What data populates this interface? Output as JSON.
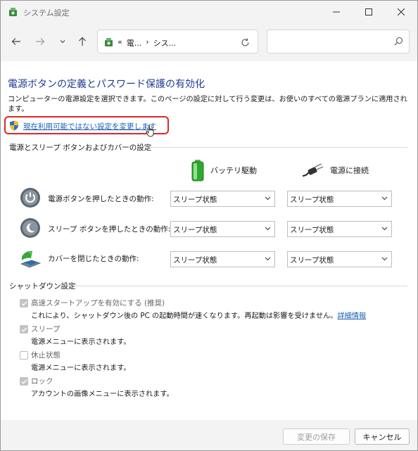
{
  "window": {
    "title": "システム設定"
  },
  "address": {
    "parts": [
      "«",
      "電...",
      "›",
      "シス..."
    ]
  },
  "search": {
    "placeholder": ""
  },
  "page": {
    "title": "電源ボタンの定義とパスワード保護の有効化",
    "description": "コンピューターの電源設定を選択できます。このページの設定に対して行う変更は、お使いのすべての電源プランに適用されます。",
    "change_link": "現在利用可能ではない設定を変更します"
  },
  "power_section": {
    "title": "電源とスリープ ボタンおよびカバーの設定",
    "battery_header": "バッテリ駆動",
    "plugged_header": "電源に接続",
    "rows": [
      {
        "label": "電源ボタンを押したときの動作:",
        "battery": "スリープ状態",
        "plugged": "スリープ状態"
      },
      {
        "label": "スリープ ボタンを押したときの動作:",
        "battery": "スリープ状態",
        "plugged": "スリープ状態"
      },
      {
        "label": "カバーを閉じたときの動作:",
        "battery": "スリープ状態",
        "plugged": "スリープ状態"
      }
    ]
  },
  "shutdown_section": {
    "title": "シャットダウン設定",
    "items": [
      {
        "label": "高速スタートアップを有効にする (推奨)",
        "checked": true,
        "description": "これにより、シャットダウン後の PC の起動時間が速くなります。再起動は影響を受けません。",
        "link": "詳細情報"
      },
      {
        "label": "スリープ",
        "checked": true,
        "description": "電源メニューに表示されます。"
      },
      {
        "label": "休止状態",
        "checked": false,
        "description": "電源メニューに表示されます。"
      },
      {
        "label": "ロック",
        "checked": true,
        "description": "アカウントの画像メニューに表示されます。"
      }
    ]
  },
  "footer": {
    "save_label": "変更の保存",
    "cancel_label": "キャンセル"
  },
  "colors": {
    "title_blue": "#1e3d91",
    "link_blue": "#1a5fb4",
    "highlight_red": "#e0262b"
  }
}
